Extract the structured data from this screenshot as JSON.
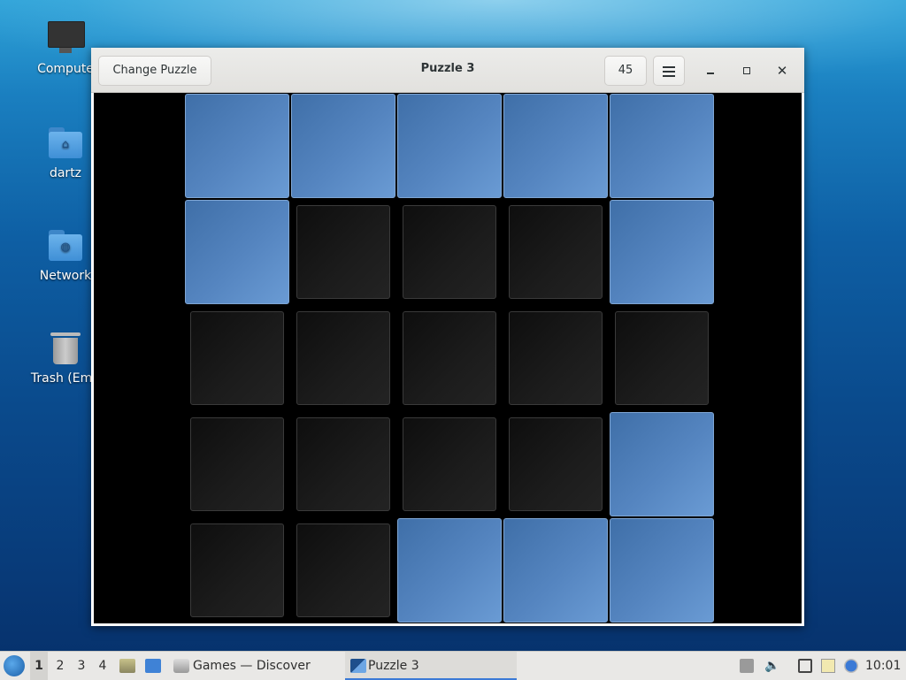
{
  "desktop": {
    "icons": [
      {
        "label": "Compute"
      },
      {
        "label": "dartz"
      },
      {
        "label": "Network"
      },
      {
        "label": "Trash (Emp"
      }
    ]
  },
  "window": {
    "title": "Puzzle 3",
    "change_label": "Change Puzzle",
    "move_count": "45",
    "minimize_glyph": "minimize-icon",
    "close_glyph": "✕"
  },
  "board": {
    "rows": 5,
    "cols": 5,
    "lit": [
      [
        1,
        1,
        1,
        1,
        1
      ],
      [
        1,
        0,
        0,
        0,
        1
      ],
      [
        0,
        0,
        0,
        0,
        0
      ],
      [
        0,
        0,
        0,
        0,
        1
      ],
      [
        0,
        0,
        1,
        1,
        1
      ]
    ],
    "on_color": "#5080bc",
    "off_color": "#151515"
  },
  "taskbar": {
    "workspaces": [
      "1",
      "2",
      "3",
      "4"
    ],
    "active_workspace": "1",
    "tasks": [
      {
        "label": "Games — Discover",
        "icon": "discover-icon"
      },
      {
        "label": "Puzzle 3",
        "icon": "puzzle-icon"
      }
    ],
    "clock": "10:01"
  }
}
